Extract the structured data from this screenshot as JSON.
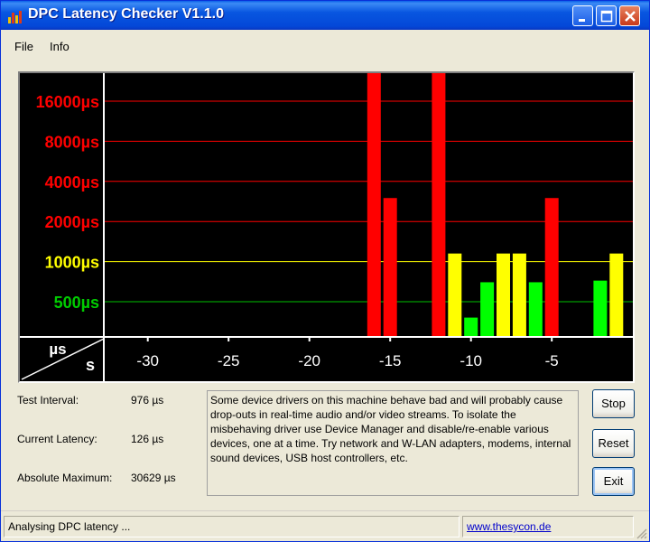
{
  "window": {
    "title": "DPC Latency Checker V1.1.0",
    "icons": {
      "app": "bar-chart-app-icon",
      "minimize": "minimize-icon",
      "maximize": "maximize-icon",
      "close": "close-icon"
    }
  },
  "menu": {
    "file": "File",
    "info": "Info"
  },
  "chart_data": {
    "type": "bar",
    "xlabel": "s",
    "ylabel": "µs",
    "x_ticks": [
      "-30",
      "-25",
      "-20",
      "-15",
      "-10",
      "-5"
    ],
    "y_ticks": [
      "16000µs",
      "8000µs",
      "4000µs",
      "2000µs",
      "1000µs",
      "500µs"
    ],
    "y_scale": "log",
    "x_range": [
      -35,
      0
    ],
    "threshold_colors": {
      "low": "#00ff00",
      "medium": "#ffff00",
      "high": "#ff0000"
    },
    "x": [
      -34,
      -33,
      -32,
      -31,
      -30,
      -29,
      -28,
      -27,
      -26,
      -25,
      -24,
      -23,
      -22,
      -21,
      -20,
      -19,
      -18,
      -17,
      -16,
      -15,
      -14,
      -13,
      -12,
      -11,
      -10,
      -9,
      -8,
      -7,
      -6,
      -5,
      -4,
      -3,
      -2,
      -1
    ],
    "values": [
      126,
      126,
      140,
      126,
      126,
      126,
      126,
      126,
      140,
      220,
      140,
      140,
      126,
      140,
      140,
      140,
      126,
      126,
      30629,
      3000,
      140,
      150,
      30629,
      1150,
      380,
      700,
      1150,
      1150,
      700,
      3000,
      126,
      140,
      720,
      1150
    ]
  },
  "info": {
    "test_interval_label": "Test Interval:",
    "test_interval_value": "976 µs",
    "current_latency_label": "Current Latency:",
    "current_latency_value": "126 µs",
    "absolute_maximum_label": "Absolute Maximum:",
    "absolute_maximum_value": "30629 µs"
  },
  "message": "Some device drivers on this machine behave bad and will probably cause drop-outs in real-time audio and/or video streams. To isolate the misbehaving driver use Device Manager and disable/re-enable various devices, one at a time. Try network and W-LAN adapters, modems, internal sound devices, USB host controllers, etc.",
  "buttons": {
    "stop": "Stop",
    "reset": "Reset",
    "exit": "Exit"
  },
  "status": {
    "text": "Analysing DPC latency ...",
    "link": "www.thesycon.de"
  }
}
